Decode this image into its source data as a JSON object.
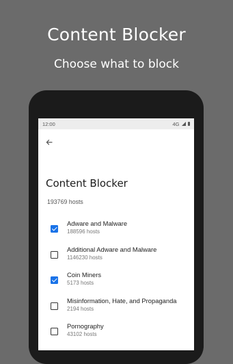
{
  "promo": {
    "title": "Content Blocker",
    "subtitle": "Choose what to block"
  },
  "status_bar": {
    "time": "12:00",
    "network": "4G"
  },
  "header": {
    "back_icon": "arrow-back-icon"
  },
  "page": {
    "title": "Content Blocker",
    "host_count": "193769 hosts"
  },
  "list": {
    "items": [
      {
        "label": "Adware and Malware",
        "hosts": "188596 hosts",
        "checked": true
      },
      {
        "label": "Additional Adware and Malware",
        "hosts": "1146230 hosts",
        "checked": false
      },
      {
        "label": "Coin Miners",
        "hosts": "5173 hosts",
        "checked": true
      },
      {
        "label": "Misinformation, Hate, and Propaganda",
        "hosts": "2194 hosts",
        "checked": false
      },
      {
        "label": "Pornography",
        "hosts": "43102 hosts",
        "checked": false
      }
    ]
  },
  "colors": {
    "background": "#6b6b6b",
    "checkbox_checked": "#1a73e8",
    "phone_frame": "#1b1b1b"
  }
}
